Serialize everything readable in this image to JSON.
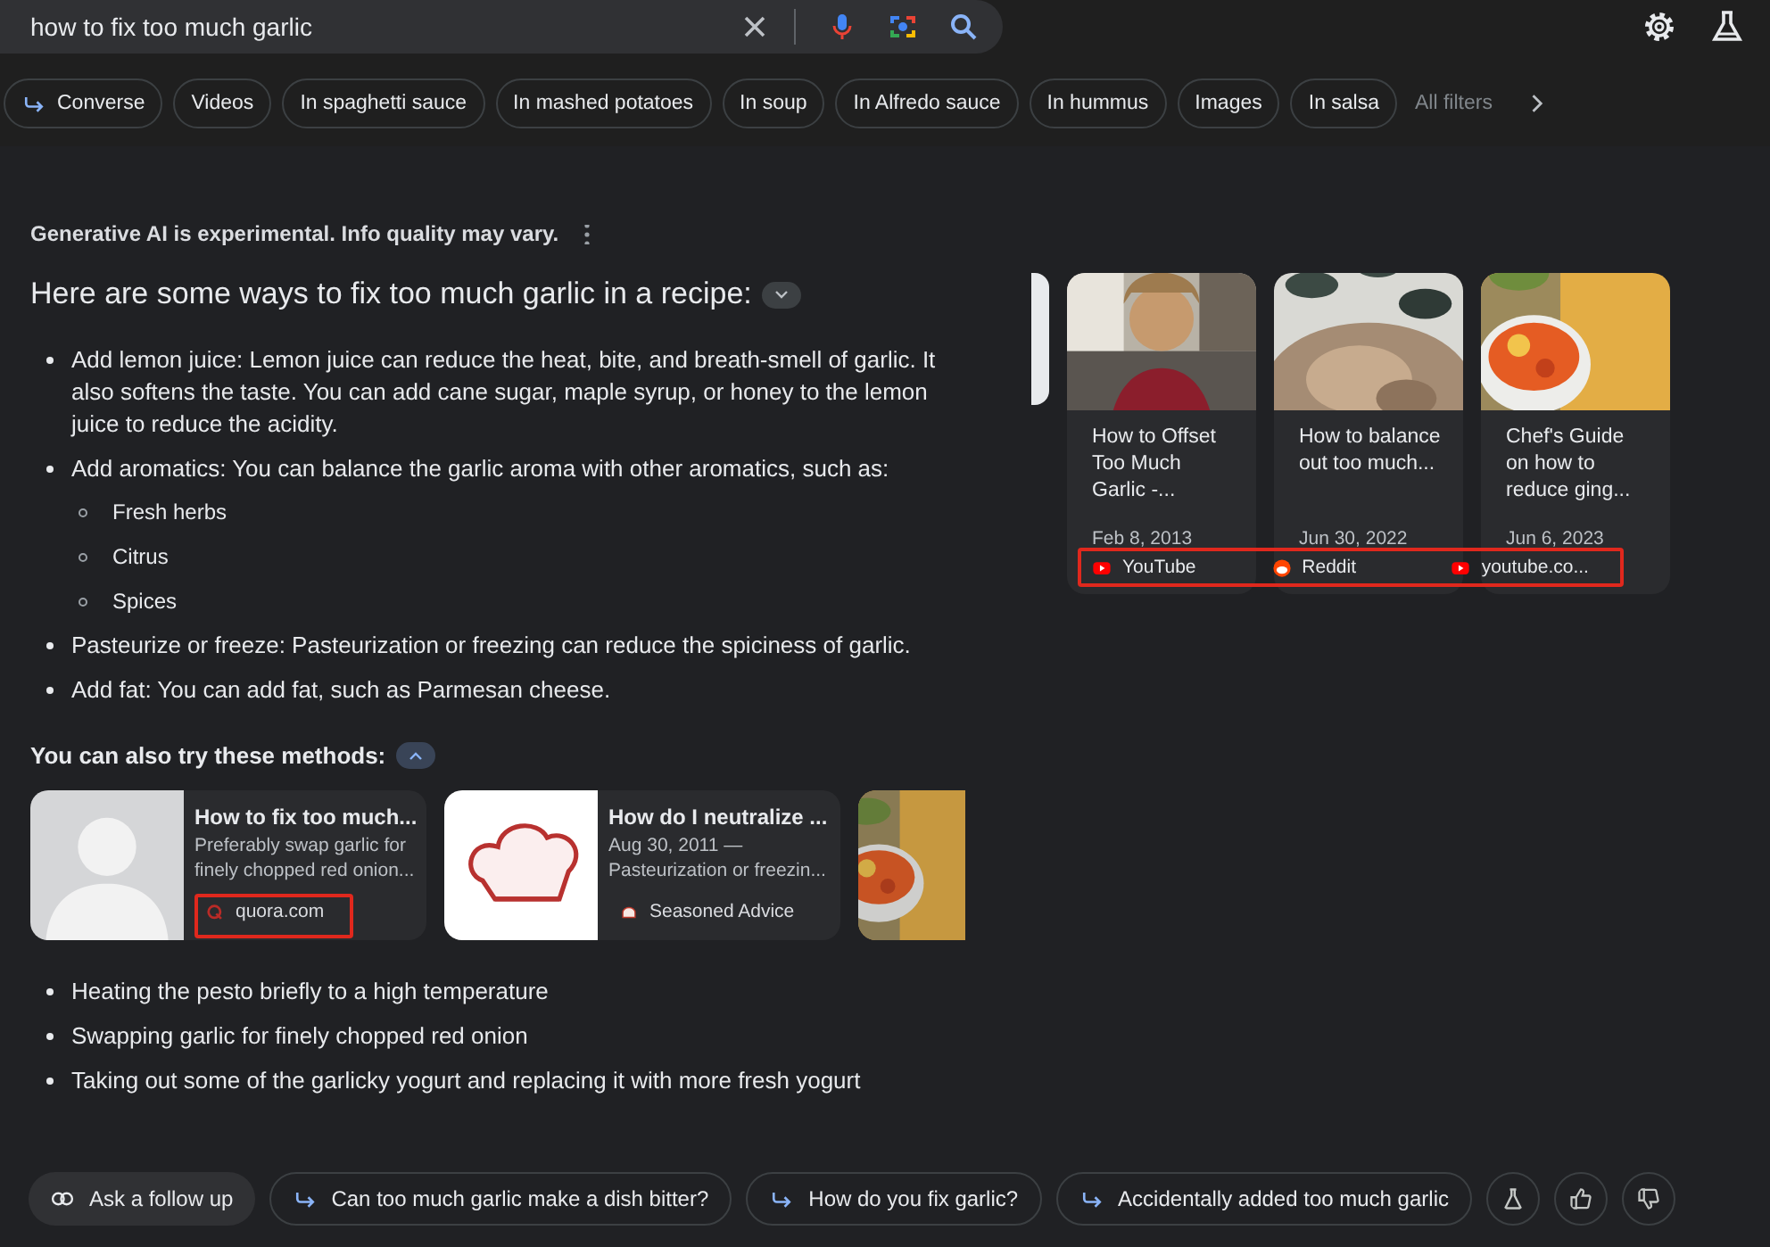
{
  "search": {
    "value": "how to fix too much garlic"
  },
  "chips": [
    {
      "label": "Converse",
      "kind": "converse"
    },
    {
      "label": "Videos",
      "kind": "plain"
    },
    {
      "label": "In spaghetti sauce",
      "kind": "plain"
    },
    {
      "label": "In mashed potatoes",
      "kind": "plain"
    },
    {
      "label": "In soup",
      "kind": "plain"
    },
    {
      "label": "In Alfredo sauce",
      "kind": "plain"
    },
    {
      "label": "In hummus",
      "kind": "plain"
    },
    {
      "label": "Images",
      "kind": "plain"
    },
    {
      "label": "In salsa",
      "kind": "plain"
    },
    {
      "label": "All filters",
      "kind": "filters"
    }
  ],
  "overview": {
    "notice": "Generative AI is experimental. Info quality may vary.",
    "heading": "Here are some ways to fix too much garlic in a recipe:",
    "heading_expanded": false,
    "bullets": [
      {
        "text": "Add lemon juice: Lemon juice can reduce the heat, bite, and breath-smell of garlic. It also softens the taste. You can add cane sugar, maple syrup, or honey to the lemon juice to reduce the acidity."
      },
      {
        "text": "Add aromatics: You can balance the garlic aroma with other aromatics, such as:",
        "children": [
          "Fresh herbs",
          "Citrus",
          "Spices"
        ]
      },
      {
        "text": "Pasteurize or freeze: Pasteurization or freezing can reduce the spiciness of garlic."
      },
      {
        "text": "Add fat: You can add fat, such as Parmesan cheese."
      }
    ],
    "also_title": "You can also try these methods:",
    "also_expanded": true,
    "cards": [
      {
        "kind": "article",
        "title": "How to fix too much...",
        "snippet": "Preferably swap garlic for finely chopped red onion...",
        "source": "quora.com",
        "highlighted": true
      },
      {
        "kind": "article",
        "title": "How do I neutralize ...",
        "snippet": "Aug 30, 2011 — Pasteurization or freezin...",
        "source": "Seasoned Advice",
        "highlighted": false
      },
      {
        "kind": "picture"
      }
    ],
    "more_bullets": [
      "Heating the pesto briefly to a high temperature",
      "Swapping garlic for finely chopped red onion",
      "Taking out some of the garlicky yogurt and replacing it with more fresh yogurt"
    ]
  },
  "videos": {
    "sources_highlighted": true,
    "items": [
      {
        "title": "How to Offset Too Much Garlic -...",
        "date": "Feb 8, 2013",
        "source": "YouTube"
      },
      {
        "title": "How to balance out too much...",
        "date": "Jun 30, 2022",
        "source": "Reddit"
      },
      {
        "title": "Chef's Guide on how to reduce ging...",
        "date": "Jun 6, 2023",
        "source": "youtube.co..."
      }
    ]
  },
  "followup": {
    "ask": "Ask a follow up",
    "suggestions": [
      "Can too much garlic make a dish bitter?",
      "How do you fix garlic?",
      "Accidentally added too much garlic"
    ]
  }
}
